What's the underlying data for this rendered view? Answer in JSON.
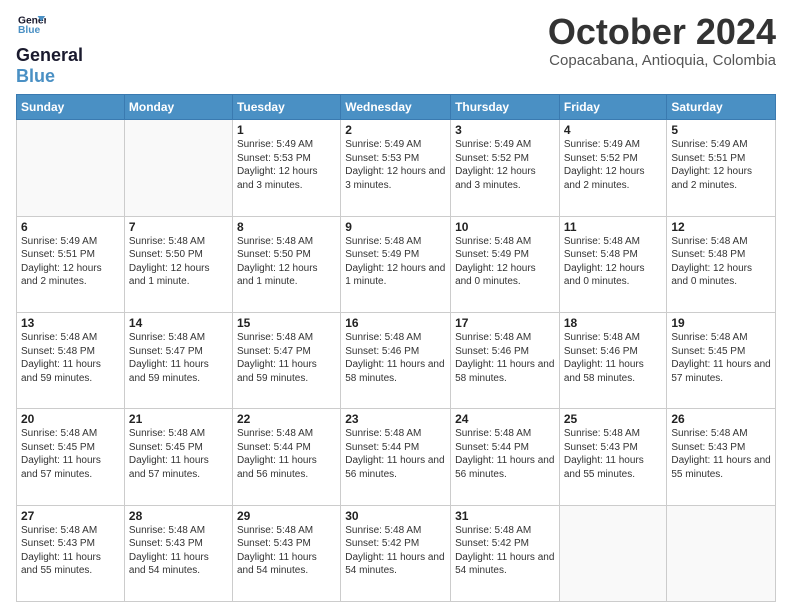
{
  "logo": {
    "line1": "General",
    "line2": "Blue"
  },
  "title": "October 2024",
  "location": "Copacabana, Antioquia, Colombia",
  "days_of_week": [
    "Sunday",
    "Monday",
    "Tuesday",
    "Wednesday",
    "Thursday",
    "Friday",
    "Saturday"
  ],
  "weeks": [
    [
      {
        "num": "",
        "info": ""
      },
      {
        "num": "",
        "info": ""
      },
      {
        "num": "1",
        "info": "Sunrise: 5:49 AM\nSunset: 5:53 PM\nDaylight: 12 hours and 3 minutes."
      },
      {
        "num": "2",
        "info": "Sunrise: 5:49 AM\nSunset: 5:53 PM\nDaylight: 12 hours and 3 minutes."
      },
      {
        "num": "3",
        "info": "Sunrise: 5:49 AM\nSunset: 5:52 PM\nDaylight: 12 hours and 3 minutes."
      },
      {
        "num": "4",
        "info": "Sunrise: 5:49 AM\nSunset: 5:52 PM\nDaylight: 12 hours and 2 minutes."
      },
      {
        "num": "5",
        "info": "Sunrise: 5:49 AM\nSunset: 5:51 PM\nDaylight: 12 hours and 2 minutes."
      }
    ],
    [
      {
        "num": "6",
        "info": "Sunrise: 5:49 AM\nSunset: 5:51 PM\nDaylight: 12 hours and 2 minutes."
      },
      {
        "num": "7",
        "info": "Sunrise: 5:48 AM\nSunset: 5:50 PM\nDaylight: 12 hours and 1 minute."
      },
      {
        "num": "8",
        "info": "Sunrise: 5:48 AM\nSunset: 5:50 PM\nDaylight: 12 hours and 1 minute."
      },
      {
        "num": "9",
        "info": "Sunrise: 5:48 AM\nSunset: 5:49 PM\nDaylight: 12 hours and 1 minute."
      },
      {
        "num": "10",
        "info": "Sunrise: 5:48 AM\nSunset: 5:49 PM\nDaylight: 12 hours and 0 minutes."
      },
      {
        "num": "11",
        "info": "Sunrise: 5:48 AM\nSunset: 5:48 PM\nDaylight: 12 hours and 0 minutes."
      },
      {
        "num": "12",
        "info": "Sunrise: 5:48 AM\nSunset: 5:48 PM\nDaylight: 12 hours and 0 minutes."
      }
    ],
    [
      {
        "num": "13",
        "info": "Sunrise: 5:48 AM\nSunset: 5:48 PM\nDaylight: 11 hours and 59 minutes."
      },
      {
        "num": "14",
        "info": "Sunrise: 5:48 AM\nSunset: 5:47 PM\nDaylight: 11 hours and 59 minutes."
      },
      {
        "num": "15",
        "info": "Sunrise: 5:48 AM\nSunset: 5:47 PM\nDaylight: 11 hours and 59 minutes."
      },
      {
        "num": "16",
        "info": "Sunrise: 5:48 AM\nSunset: 5:46 PM\nDaylight: 11 hours and 58 minutes."
      },
      {
        "num": "17",
        "info": "Sunrise: 5:48 AM\nSunset: 5:46 PM\nDaylight: 11 hours and 58 minutes."
      },
      {
        "num": "18",
        "info": "Sunrise: 5:48 AM\nSunset: 5:46 PM\nDaylight: 11 hours and 58 minutes."
      },
      {
        "num": "19",
        "info": "Sunrise: 5:48 AM\nSunset: 5:45 PM\nDaylight: 11 hours and 57 minutes."
      }
    ],
    [
      {
        "num": "20",
        "info": "Sunrise: 5:48 AM\nSunset: 5:45 PM\nDaylight: 11 hours and 57 minutes."
      },
      {
        "num": "21",
        "info": "Sunrise: 5:48 AM\nSunset: 5:45 PM\nDaylight: 11 hours and 57 minutes."
      },
      {
        "num": "22",
        "info": "Sunrise: 5:48 AM\nSunset: 5:44 PM\nDaylight: 11 hours and 56 minutes."
      },
      {
        "num": "23",
        "info": "Sunrise: 5:48 AM\nSunset: 5:44 PM\nDaylight: 11 hours and 56 minutes."
      },
      {
        "num": "24",
        "info": "Sunrise: 5:48 AM\nSunset: 5:44 PM\nDaylight: 11 hours and 56 minutes."
      },
      {
        "num": "25",
        "info": "Sunrise: 5:48 AM\nSunset: 5:43 PM\nDaylight: 11 hours and 55 minutes."
      },
      {
        "num": "26",
        "info": "Sunrise: 5:48 AM\nSunset: 5:43 PM\nDaylight: 11 hours and 55 minutes."
      }
    ],
    [
      {
        "num": "27",
        "info": "Sunrise: 5:48 AM\nSunset: 5:43 PM\nDaylight: 11 hours and 55 minutes."
      },
      {
        "num": "28",
        "info": "Sunrise: 5:48 AM\nSunset: 5:43 PM\nDaylight: 11 hours and 54 minutes."
      },
      {
        "num": "29",
        "info": "Sunrise: 5:48 AM\nSunset: 5:43 PM\nDaylight: 11 hours and 54 minutes."
      },
      {
        "num": "30",
        "info": "Sunrise: 5:48 AM\nSunset: 5:42 PM\nDaylight: 11 hours and 54 minutes."
      },
      {
        "num": "31",
        "info": "Sunrise: 5:48 AM\nSunset: 5:42 PM\nDaylight: 11 hours and 54 minutes."
      },
      {
        "num": "",
        "info": ""
      },
      {
        "num": "",
        "info": ""
      }
    ]
  ]
}
